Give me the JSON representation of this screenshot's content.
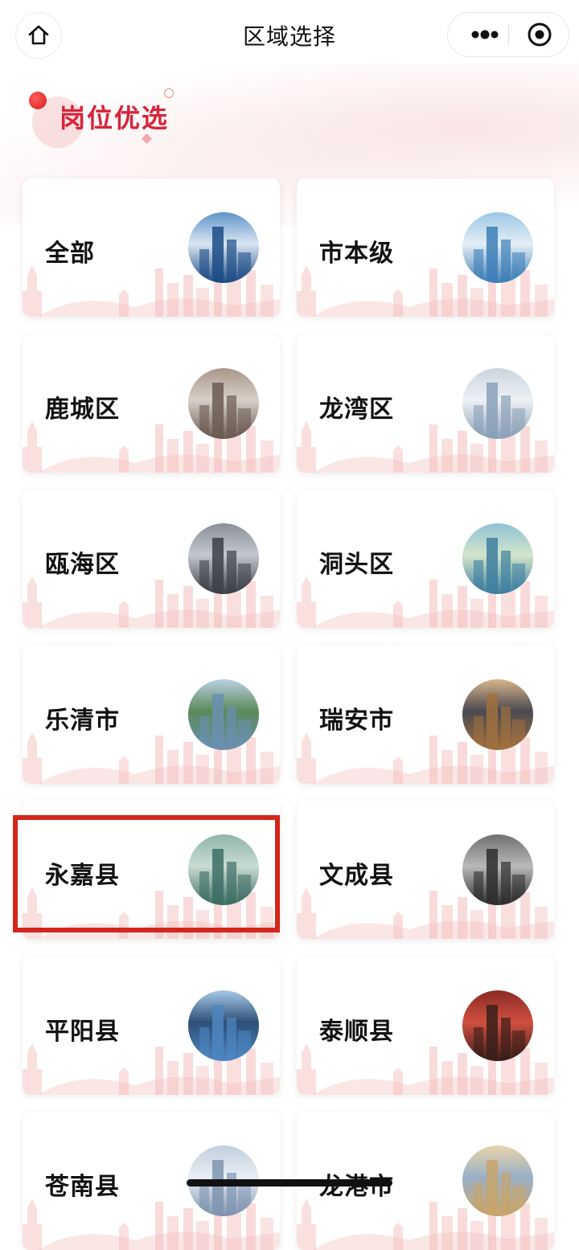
{
  "window": {
    "title": "区域选择"
  },
  "section": {
    "title": "岗位优选"
  },
  "regions": [
    {
      "label": "全部",
      "photo_icon": "city-night-tower-photo",
      "selected": false
    },
    {
      "label": "市本级",
      "photo_icon": "tall-tower-photo",
      "selected": false
    },
    {
      "label": "鹿城区",
      "photo_icon": "building-1868-photo",
      "selected": false
    },
    {
      "label": "龙湾区",
      "photo_icon": "high-rise-photo",
      "selected": false
    },
    {
      "label": "瓯海区",
      "photo_icon": "office-tower-photo",
      "selected": false
    },
    {
      "label": "洞头区",
      "photo_icon": "harbor-photo",
      "selected": false
    },
    {
      "label": "乐清市",
      "photo_icon": "waterfront-photo",
      "selected": false
    },
    {
      "label": "瑞安市",
      "photo_icon": "apartments-photo",
      "selected": false
    },
    {
      "label": "永嘉县",
      "photo_icon": "green-hill-photo",
      "selected": true
    },
    {
      "label": "文成县",
      "photo_icon": "hillside-village-photo",
      "selected": false
    },
    {
      "label": "平阳县",
      "photo_icon": "skyscraper-photo",
      "selected": false
    },
    {
      "label": "泰顺县",
      "photo_icon": "covered-bridge-photo",
      "selected": false
    },
    {
      "label": "苍南县",
      "photo_icon": "city-aerial-photo",
      "selected": false
    },
    {
      "label": "龙港市",
      "photo_icon": "sunset-city-photo",
      "selected": false
    }
  ],
  "colors": {
    "accent": "#d7243a",
    "highlight": "#d4261c",
    "skyline": "#f3b8b8"
  }
}
